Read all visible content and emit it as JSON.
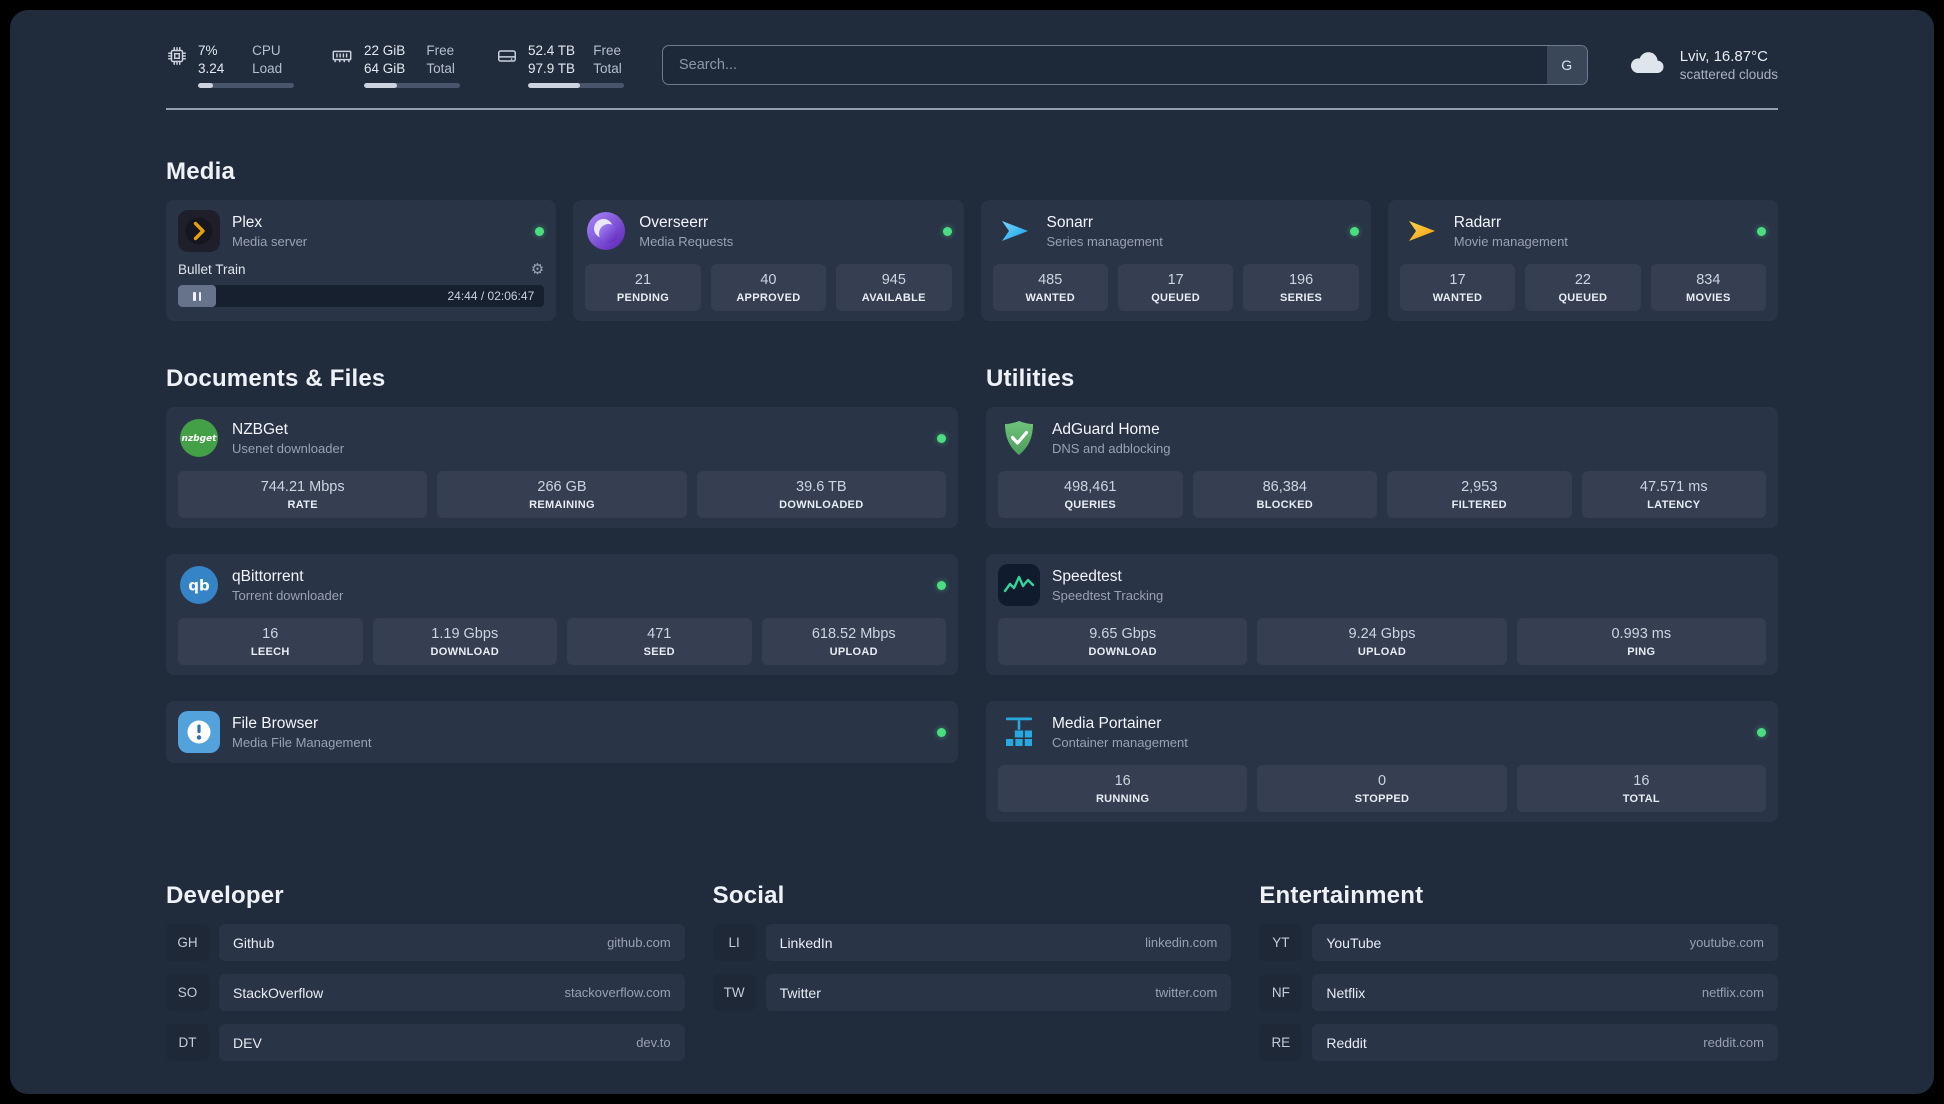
{
  "colors": {
    "background": "#202b3c",
    "card": "#2a3447",
    "status_online": "#4ade80",
    "accent_plex": "#e5a00d"
  },
  "topbar": {
    "resources": [
      {
        "icon": "cpu-icon",
        "rows": [
          {
            "value": "7%",
            "label": "CPU"
          },
          {
            "value": "3.24",
            "label": "Load"
          }
        ],
        "progress": 16
      },
      {
        "icon": "memory-icon",
        "rows": [
          {
            "value": "22 GiB",
            "label": "Free"
          },
          {
            "value": "64 GiB",
            "label": "Total"
          }
        ],
        "progress": 34
      },
      {
        "icon": "disk-icon",
        "rows": [
          {
            "value": "52.4 TB",
            "label": "Free"
          },
          {
            "value": "97.9 TB",
            "label": "Total"
          }
        ],
        "progress": 54
      }
    ],
    "search": {
      "placeholder": "Search...",
      "button_label": "G"
    },
    "weather": {
      "icon": "cloud-icon",
      "location": "Lviv, 16.87°C",
      "condition": "scattered clouds"
    }
  },
  "groups": {
    "media": {
      "title": "Media",
      "cards": {
        "plex": {
          "name": "Plex",
          "desc": "Media server",
          "status": "online",
          "media": {
            "title": "Bullet Train",
            "time": "24:44 / 02:06:47",
            "gear": "⚙"
          }
        },
        "overseerr": {
          "name": "Overseerr",
          "desc": "Media Requests",
          "status": "online",
          "stats": [
            {
              "value": "21",
              "label": "PENDING"
            },
            {
              "value": "40",
              "label": "APPROVED"
            },
            {
              "value": "945",
              "label": "AVAILABLE"
            }
          ]
        },
        "sonarr": {
          "name": "Sonarr",
          "desc": "Series management",
          "status": "online",
          "stats": [
            {
              "value": "485",
              "label": "WANTED"
            },
            {
              "value": "17",
              "label": "QUEUED"
            },
            {
              "value": "196",
              "label": "SERIES"
            }
          ]
        },
        "radarr": {
          "name": "Radarr",
          "desc": "Movie management",
          "status": "online",
          "stats": [
            {
              "value": "17",
              "label": "WANTED"
            },
            {
              "value": "22",
              "label": "QUEUED"
            },
            {
              "value": "834",
              "label": "MOVIES"
            }
          ]
        }
      }
    },
    "documents": {
      "title": "Documents & Files",
      "cards": {
        "nzbget": {
          "name": "NZBGet",
          "desc": "Usenet downloader",
          "status": "online",
          "stats": [
            {
              "value": "744.21 Mbps",
              "label": "RATE"
            },
            {
              "value": "266 GB",
              "label": "REMAINING"
            },
            {
              "value": "39.6 TB",
              "label": "DOWNLOADED"
            }
          ]
        },
        "qbittorrent": {
          "name": "qBittorrent",
          "desc": "Torrent downloader",
          "status": "online",
          "stats": [
            {
              "value": "16",
              "label": "LEECH"
            },
            {
              "value": "1.19 Gbps",
              "label": "DOWNLOAD"
            },
            {
              "value": "471",
              "label": "SEED"
            },
            {
              "value": "618.52 Mbps",
              "label": "UPLOAD"
            }
          ]
        },
        "filebrowser": {
          "name": "File Browser",
          "desc": "Media File Management",
          "status": "online"
        }
      }
    },
    "utilities": {
      "title": "Utilities",
      "cards": {
        "adguard": {
          "name": "AdGuard Home",
          "desc": "DNS and adblocking",
          "stats": [
            {
              "value": "498,461",
              "label": "QUERIES"
            },
            {
              "value": "86,384",
              "label": "BLOCKED"
            },
            {
              "value": "2,953",
              "label": "FILTERED"
            },
            {
              "value": "47.571 ms",
              "label": "LATENCY"
            }
          ]
        },
        "speedtest": {
          "name": "Speedtest",
          "desc": "Speedtest Tracking",
          "stats": [
            {
              "value": "9.65 Gbps",
              "label": "DOWNLOAD"
            },
            {
              "value": "9.24 Gbps",
              "label": "UPLOAD"
            },
            {
              "value": "0.993 ms",
              "label": "PING"
            }
          ]
        },
        "portainer": {
          "name": "Media Portainer",
          "desc": "Container management",
          "status": "online",
          "stats": [
            {
              "value": "16",
              "label": "RUNNING"
            },
            {
              "value": "0",
              "label": "STOPPED"
            },
            {
              "value": "16",
              "label": "TOTAL"
            }
          ]
        }
      }
    }
  },
  "bookmarks": {
    "developer": {
      "title": "Developer",
      "items": [
        {
          "abbr": "GH",
          "name": "Github",
          "url": "github.com"
        },
        {
          "abbr": "SO",
          "name": "StackOverflow",
          "url": "stackoverflow.com"
        },
        {
          "abbr": "DT",
          "name": "DEV",
          "url": "dev.to"
        }
      ]
    },
    "social": {
      "title": "Social",
      "items": [
        {
          "abbr": "LI",
          "name": "LinkedIn",
          "url": "linkedin.com"
        },
        {
          "abbr": "TW",
          "name": "Twitter",
          "url": "twitter.com"
        }
      ]
    },
    "entertainment": {
      "title": "Entertainment",
      "items": [
        {
          "abbr": "YT",
          "name": "YouTube",
          "url": "youtube.com"
        },
        {
          "abbr": "NF",
          "name": "Netflix",
          "url": "netflix.com"
        },
        {
          "abbr": "RE",
          "name": "Reddit",
          "url": "reddit.com"
        }
      ]
    }
  }
}
